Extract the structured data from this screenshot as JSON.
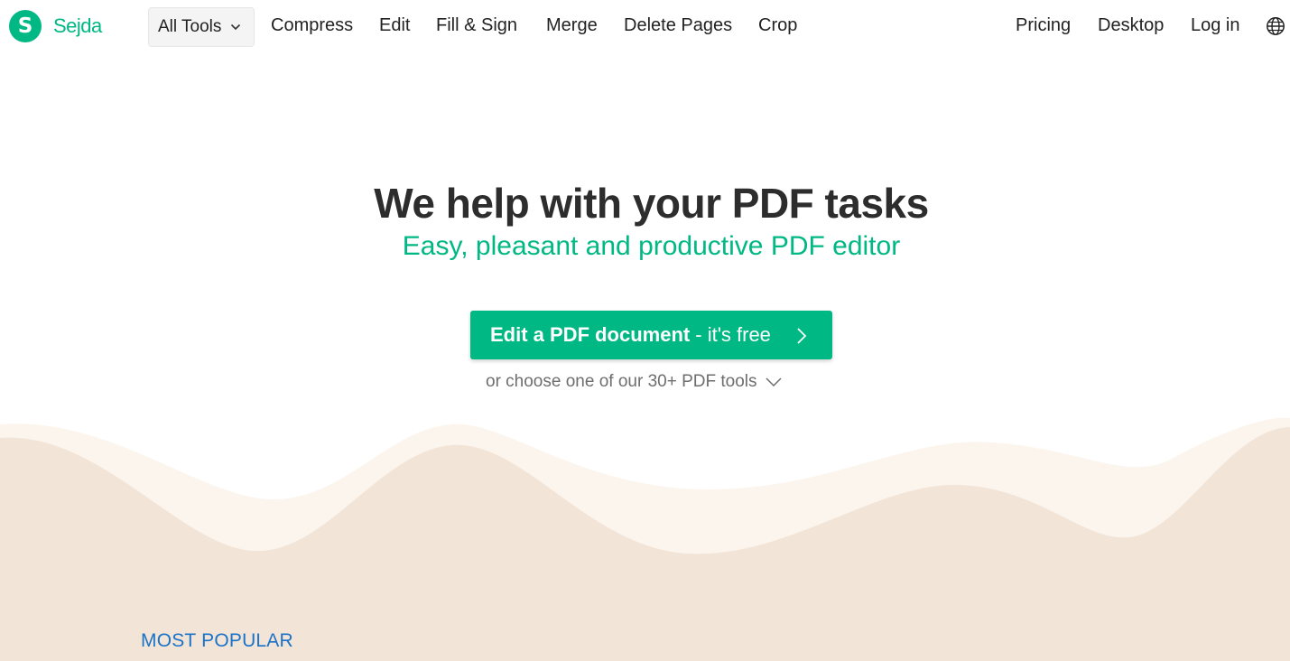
{
  "brand": {
    "logo_letter": "S",
    "name": "Sejda",
    "accent_color": "#00b883"
  },
  "header": {
    "all_tools_label": "All Tools",
    "nav_left": [
      "Compress",
      "Edit",
      "Fill & Sign",
      "Merge",
      "Delete Pages",
      "Crop"
    ],
    "nav_right": [
      "Pricing",
      "Desktop",
      "Log in"
    ],
    "language_icon": "globe-icon"
  },
  "hero": {
    "title": "We help with your PDF tasks",
    "subtitle": "Easy, pleasant and productive PDF editor",
    "cta_strong": "Edit a PDF document",
    "cta_light": "- it's free",
    "cta_icon": "chevron-right-icon",
    "choose_text": "or choose one of our 30+ PDF tools",
    "choose_icon": "chevron-down-icon"
  },
  "sections": {
    "most_popular_label": "MOST POPULAR"
  },
  "colors": {
    "wave_light": "#fbf5ee",
    "wave_dark": "#f2e4d7",
    "section_label": "#1a73c8"
  }
}
